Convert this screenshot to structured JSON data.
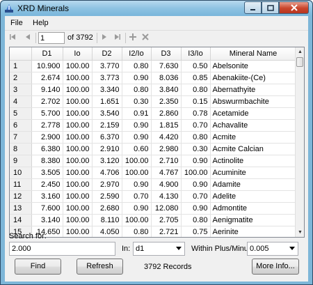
{
  "window": {
    "title": "XRD Minerals"
  },
  "menu": [
    {
      "label": "File"
    },
    {
      "label": "Help"
    }
  ],
  "toolbar": {
    "position_value": "1",
    "of_text": "of 3792"
  },
  "table": {
    "columns": [
      "D1",
      "Io",
      "D2",
      "I2/Io",
      "D3",
      "I3/Io",
      "Mineral Name"
    ],
    "rows": [
      [
        "1",
        "10.900",
        "100.00",
        "3.770",
        "0.80",
        "7.630",
        "0.50",
        "Abelsonite"
      ],
      [
        "2",
        "2.674",
        "100.00",
        "3.773",
        "0.90",
        "8.036",
        "0.85",
        "Abenakiite-(Ce)"
      ],
      [
        "3",
        "9.140",
        "100.00",
        "3.340",
        "0.80",
        "3.840",
        "0.80",
        "Abernathyite"
      ],
      [
        "4",
        "2.702",
        "100.00",
        "1.651",
        "0.30",
        "2.350",
        "0.15",
        "Abswurmbachite"
      ],
      [
        "5",
        "5.700",
        "100.00",
        "3.540",
        "0.91",
        "2.860",
        "0.78",
        "Acetamide"
      ],
      [
        "6",
        "2.778",
        "100.00",
        "2.159",
        "0.90",
        "1.815",
        "0.70",
        "Achavalite"
      ],
      [
        "7",
        "2.900",
        "100.00",
        "6.370",
        "0.90",
        "4.420",
        "0.80",
        "Acmite"
      ],
      [
        "8",
        "6.380",
        "100.00",
        "2.910",
        "0.60",
        "2.980",
        "0.30",
        "Acmite Calcian"
      ],
      [
        "9",
        "8.380",
        "100.00",
        "3.120",
        "100.00",
        "2.710",
        "0.90",
        "Actinolite"
      ],
      [
        "10",
        "3.505",
        "100.00",
        "4.706",
        "100.00",
        "4.767",
        "100.00",
        "Acuminite"
      ],
      [
        "11",
        "2.450",
        "100.00",
        "2.970",
        "0.90",
        "4.900",
        "0.90",
        "Adamite"
      ],
      [
        "12",
        "3.160",
        "100.00",
        "2.590",
        "0.70",
        "4.130",
        "0.70",
        "Adelite"
      ],
      [
        "13",
        "7.600",
        "100.00",
        "2.680",
        "0.90",
        "12.080",
        "0.90",
        "Admontite"
      ],
      [
        "14",
        "3.140",
        "100.00",
        "8.110",
        "100.00",
        "2.705",
        "0.80",
        "Aenigmatite"
      ],
      [
        "15",
        "14.650",
        "100.00",
        "4.050",
        "0.80",
        "2.721",
        "0.75",
        "Aerinite"
      ]
    ]
  },
  "search": {
    "label": "Search for:",
    "value": "2.000",
    "in_label": "In:",
    "in_value": "d1",
    "within_label": "Within Plus/Minus:",
    "within_value": "0.005"
  },
  "buttons": {
    "find": "Find",
    "refresh": "Refresh",
    "more_info": "More Info..."
  },
  "status": {
    "records": "3792 Records"
  }
}
